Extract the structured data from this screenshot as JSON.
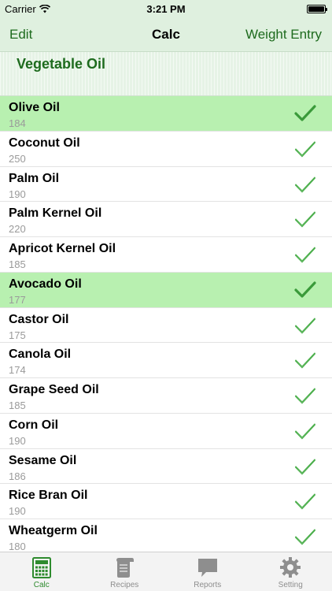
{
  "status": {
    "carrier": "Carrier",
    "time": "3:21 PM",
    "battery_level": 1.0
  },
  "nav": {
    "left": "Edit",
    "title": "Calc",
    "right": "Weight Entry"
  },
  "header": {
    "category": "Vegetable Oil"
  },
  "oils": [
    {
      "name": "Olive Oil",
      "value": "184",
      "selected": true
    },
    {
      "name": "Coconut Oil",
      "value": "250",
      "selected": false
    },
    {
      "name": "Palm Oil",
      "value": "190",
      "selected": false
    },
    {
      "name": "Palm Kernel Oil",
      "value": "220",
      "selected": false
    },
    {
      "name": "Apricot Kernel Oil",
      "value": "185",
      "selected": false
    },
    {
      "name": "Avocado Oil",
      "value": "177",
      "selected": true
    },
    {
      "name": "Castor Oil",
      "value": "175",
      "selected": false
    },
    {
      "name": "Canola Oil",
      "value": "174",
      "selected": false
    },
    {
      "name": "Grape Seed Oil",
      "value": "185",
      "selected": false
    },
    {
      "name": "Corn Oil",
      "value": "190",
      "selected": false
    },
    {
      "name": "Sesame Oil",
      "value": "186",
      "selected": false
    },
    {
      "name": "Rice Bran Oil",
      "value": "190",
      "selected": false
    },
    {
      "name": "Wheatgerm Oil",
      "value": "180",
      "selected": false
    }
  ],
  "tabs": [
    {
      "label": "Calc",
      "icon": "calculator-icon",
      "active": true
    },
    {
      "label": "Recipes",
      "icon": "recipes-icon",
      "active": false
    },
    {
      "label": "Reports",
      "icon": "reports-icon",
      "active": false
    },
    {
      "label": "Setting",
      "icon": "gear-icon",
      "active": false
    }
  ],
  "colors": {
    "accent": "#1e6b1e",
    "selected_row": "#b8f0b0",
    "bar_background": "#dff0df",
    "check_selected": "#3a9a3a",
    "check_unselected": "#4caf4c",
    "tab_active": "#2e8b2e",
    "tab_inactive": "#8e8e8e"
  }
}
